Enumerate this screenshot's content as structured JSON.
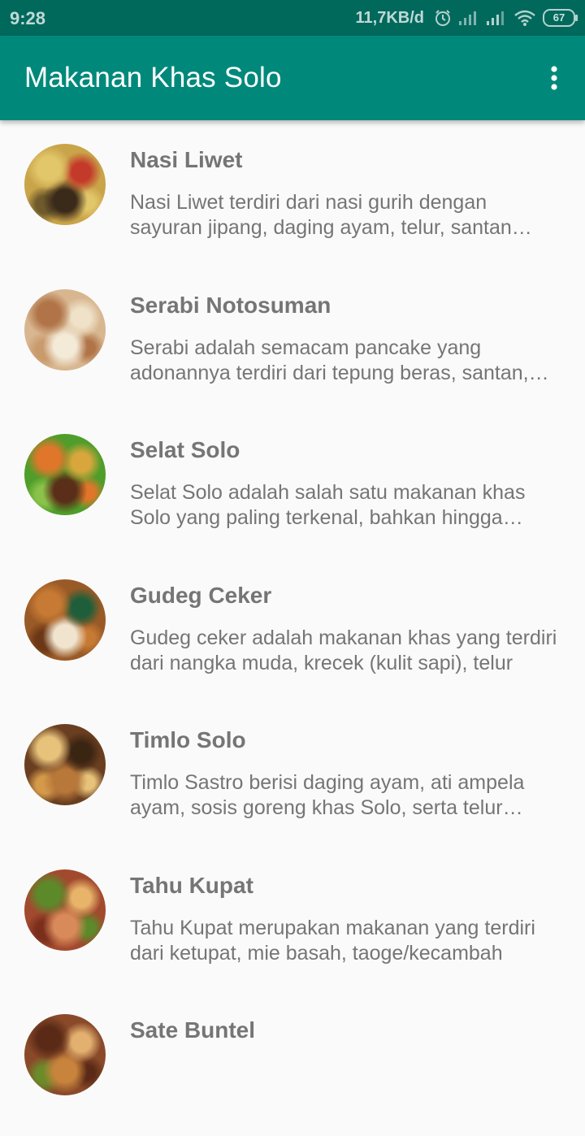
{
  "status_bar": {
    "time": "9:28",
    "network_speed": "11,7KB/d",
    "battery": "67",
    "icons": [
      "alarm-icon",
      "signal-icon",
      "signal-icon",
      "wifi-icon",
      "battery-icon"
    ]
  },
  "app_bar": {
    "title": "Makanan Khas Solo",
    "menu_icon": "more-vert-icon",
    "background": "#00897b"
  },
  "items": [
    {
      "name": "Nasi Liwet",
      "description": "Nasi Liwet terdiri dari nasi gurih dengan sayuran jipang, daging ayam, telur, santan kental",
      "colors": [
        "#c9a449",
        "#3a2a1a",
        "#e2c66a",
        "#c43a2a",
        "#6e5a2c"
      ]
    },
    {
      "name": "Serabi Notosuman",
      "description": "Serabi adalah semacam pancake yang adonannya terdiri dari tepung beras, santan, dan gula",
      "colors": [
        "#d8b690",
        "#f3ead8",
        "#b07448",
        "#efe2c8",
        "#c89a6c"
      ]
    },
    {
      "name": "Selat Solo",
      "description": "Selat Solo adalah salah satu makanan khas Solo yang paling terkenal, bahkan hingga mancanegara",
      "colors": [
        "#4f9d2a",
        "#5a2e18",
        "#e0762a",
        "#d9a63c",
        "#8bc34a"
      ]
    },
    {
      "name": "Gudeg Ceker",
      "description": "Gudeg ceker adalah makanan khas yang terdiri dari nangka muda, krecek (kulit sapi), telur",
      "colors": [
        "#9a5a26",
        "#f1e4cf",
        "#c77a34",
        "#1f5e3a",
        "#6b3716"
      ]
    },
    {
      "name": "Timlo Solo",
      "description": "Timlo Sastro berisi daging ayam, ati ampela ayam, sosis goreng khas Solo, serta telur pindang",
      "colors": [
        "#6a3e20",
        "#b8783a",
        "#e6c27a",
        "#3a2412",
        "#d49a4a"
      ]
    },
    {
      "name": "Tahu Kupat",
      "description": "Tahu Kupat merupakan makanan yang terdiri dari ketupat, mie basah, taoge/kecambah",
      "colors": [
        "#a24a2e",
        "#d98a5a",
        "#5c8a2a",
        "#e8b46a",
        "#7a2e1c"
      ]
    },
    {
      "name": "Sate Buntel",
      "description": "",
      "colors": [
        "#8a4a2a",
        "#c8843c",
        "#5a2a16",
        "#e3b070",
        "#6b8a2a"
      ]
    }
  ]
}
